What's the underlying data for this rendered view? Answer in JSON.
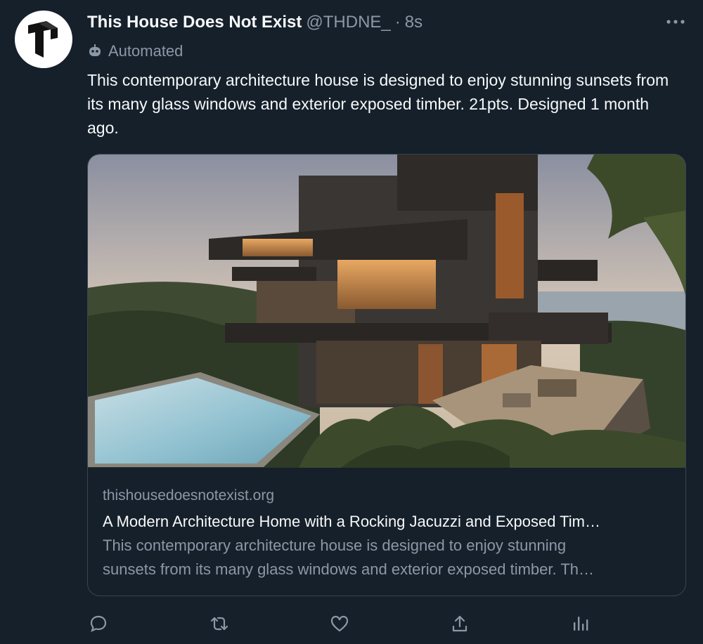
{
  "tweet": {
    "display_name": "This House Does Not Exist",
    "handle": "@THDNE_",
    "separator": "·",
    "time": "8s",
    "automated_label": "Automated",
    "text": "This contemporary architecture house is designed to enjoy stunning sunsets from its many glass windows and exterior exposed timber. 21pts. Designed 1 month ago."
  },
  "card": {
    "domain": "thishousedoesnotexist.org",
    "title": "A Modern Architecture Home with a Rocking Jacuzzi and Exposed Tim…",
    "description_line1": "This contemporary architecture house is designed to enjoy stunning",
    "description_line2": "sunsets from its many glass windows and exterior exposed timber. Th…",
    "image_icon": "house-photo"
  },
  "actions": [
    "reply-icon",
    "retweet-icon",
    "like-icon",
    "share-icon",
    "analytics-icon"
  ],
  "colors": {
    "background": "#15202b",
    "text_primary": "#f7f9f9",
    "text_secondary": "#8b98a5",
    "border": "#38444d"
  }
}
